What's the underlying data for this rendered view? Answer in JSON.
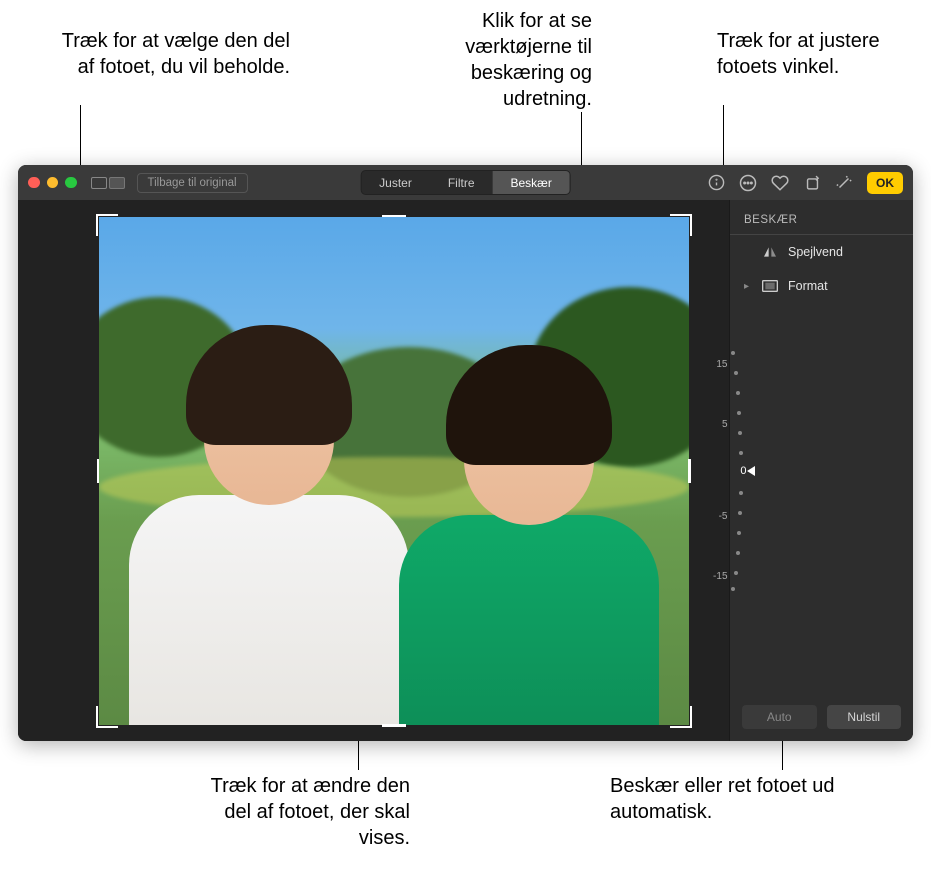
{
  "callouts": {
    "topLeft": "Træk for at vælge den del af fotoet, du vil beholde.",
    "topCenter": "Klik for at se værktøjerne til beskæring og udretning.",
    "topRight": "Træk for at justere fotoets vinkel.",
    "bottomLeft": "Træk for at ændre den del af fotoet, der skal vises.",
    "bottomRight": "Beskær eller ret fotoet ud automatisk."
  },
  "toolbar": {
    "revert": "Tilbage til original",
    "tabs": {
      "adjust": "Juster",
      "filters": "Filtre",
      "crop": "Beskær"
    },
    "done": "OK"
  },
  "sidebar": {
    "title": "BESKÆR",
    "flip": "Spejlvend",
    "aspect": "Format",
    "auto": "Auto",
    "reset": "Nulstil"
  },
  "dial": {
    "labels": [
      "15",
      "5",
      "0",
      "-5",
      "-15"
    ],
    "center": "0"
  }
}
